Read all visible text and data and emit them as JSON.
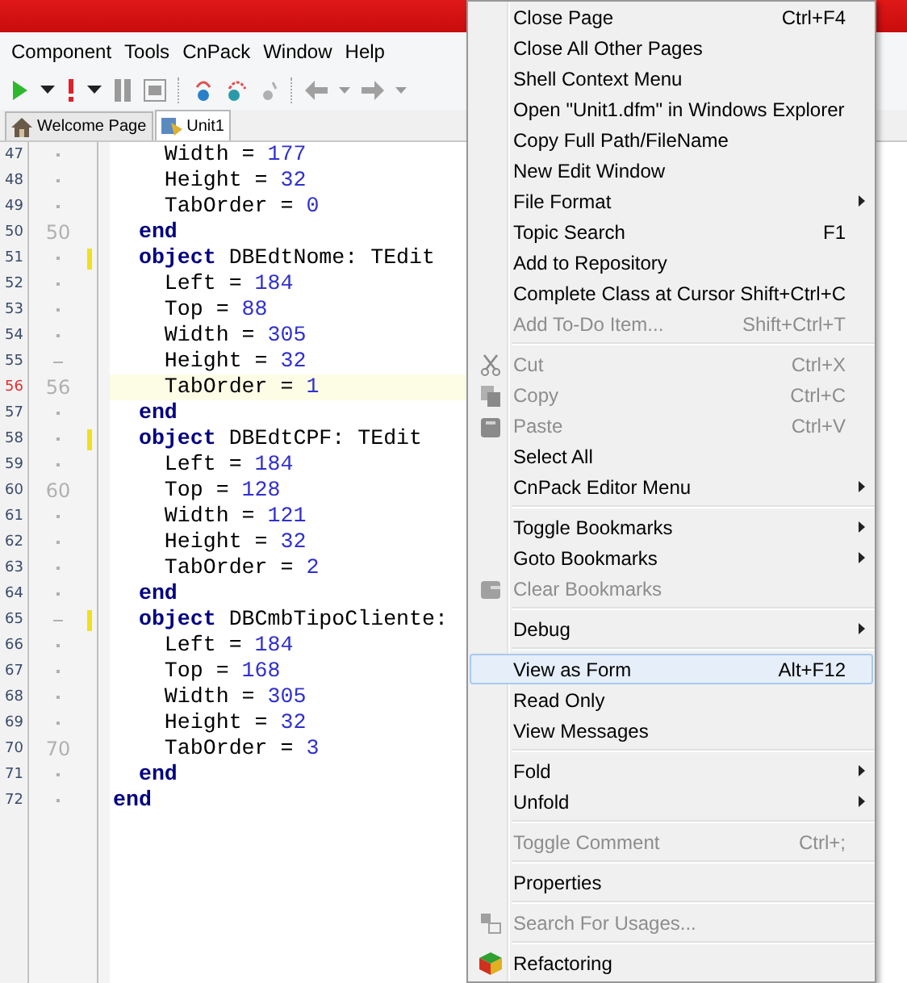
{
  "menubar": [
    "Component",
    "Tools",
    "CnPack",
    "Window",
    "Help"
  ],
  "tabs": [
    {
      "label": "Welcome Page",
      "selected": false
    },
    {
      "label": "Unit1",
      "selected": true
    }
  ],
  "editor": {
    "lines": [
      {
        "number": "47",
        "fold_start": false,
        "modified": false,
        "current": false,
        "tokens": [
          {
            "kind": "plain",
            "text": "    Width = "
          },
          {
            "kind": "number",
            "text": "177"
          }
        ]
      },
      {
        "number": "48",
        "fold_start": false,
        "modified": false,
        "current": false,
        "tokens": [
          {
            "kind": "plain",
            "text": "    Height = "
          },
          {
            "kind": "number",
            "text": "32"
          }
        ]
      },
      {
        "number": "49",
        "fold_start": false,
        "modified": false,
        "current": false,
        "tokens": [
          {
            "kind": "plain",
            "text": "    TabOrder = "
          },
          {
            "kind": "number",
            "text": "0"
          }
        ]
      },
      {
        "number": "50",
        "gutter_number": "50",
        "modified": false,
        "current": false,
        "tokens": [
          {
            "kind": "keyword",
            "text": "  end"
          }
        ]
      },
      {
        "number": "51",
        "fold_start": false,
        "modified": true,
        "current": false,
        "tokens": [
          {
            "kind": "keyword",
            "text": "  object"
          },
          {
            "kind": "plain",
            "text": " DBEdtNome: TEdit"
          }
        ]
      },
      {
        "number": "52",
        "fold_start": false,
        "modified": false,
        "current": false,
        "tokens": [
          {
            "kind": "plain",
            "text": "    Left = "
          },
          {
            "kind": "number",
            "text": "184"
          }
        ]
      },
      {
        "number": "53",
        "fold_start": false,
        "modified": false,
        "current": false,
        "tokens": [
          {
            "kind": "plain",
            "text": "    Top = "
          },
          {
            "kind": "number",
            "text": "88"
          }
        ]
      },
      {
        "number": "54",
        "fold_start": false,
        "modified": false,
        "current": false,
        "tokens": [
          {
            "kind": "plain",
            "text": "    Width = "
          },
          {
            "kind": "number",
            "text": "305"
          }
        ]
      },
      {
        "number": "55",
        "fold_start": true,
        "modified": false,
        "current": false,
        "tokens": [
          {
            "kind": "plain",
            "text": "    Height = "
          },
          {
            "kind": "number",
            "text": "32"
          }
        ]
      },
      {
        "number": "56",
        "gutter_number": "56",
        "modified": false,
        "current": true,
        "tokens": [
          {
            "kind": "plain",
            "text": "    TabOrder = "
          },
          {
            "kind": "number",
            "text": "1"
          }
        ]
      },
      {
        "number": "57",
        "fold_start": false,
        "modified": false,
        "current": false,
        "tokens": [
          {
            "kind": "keyword",
            "text": "  end"
          }
        ]
      },
      {
        "number": "58",
        "fold_start": false,
        "modified": true,
        "current": false,
        "tokens": [
          {
            "kind": "keyword",
            "text": "  object"
          },
          {
            "kind": "plain",
            "text": " DBEdtCPF: TEdit"
          }
        ]
      },
      {
        "number": "59",
        "fold_start": false,
        "modified": false,
        "current": false,
        "tokens": [
          {
            "kind": "plain",
            "text": "    Left = "
          },
          {
            "kind": "number",
            "text": "184"
          }
        ]
      },
      {
        "number": "60",
        "gutter_number": "60",
        "modified": false,
        "current": false,
        "tokens": [
          {
            "kind": "plain",
            "text": "    Top = "
          },
          {
            "kind": "number",
            "text": "128"
          }
        ]
      },
      {
        "number": "61",
        "fold_start": false,
        "modified": false,
        "current": false,
        "tokens": [
          {
            "kind": "plain",
            "text": "    Width = "
          },
          {
            "kind": "number",
            "text": "121"
          }
        ]
      },
      {
        "number": "62",
        "fold_start": false,
        "modified": false,
        "current": false,
        "tokens": [
          {
            "kind": "plain",
            "text": "    Height = "
          },
          {
            "kind": "number",
            "text": "32"
          }
        ]
      },
      {
        "number": "63",
        "fold_start": false,
        "modified": false,
        "current": false,
        "tokens": [
          {
            "kind": "plain",
            "text": "    TabOrder = "
          },
          {
            "kind": "number",
            "text": "2"
          }
        ]
      },
      {
        "number": "64",
        "fold_start": false,
        "modified": false,
        "current": false,
        "tokens": [
          {
            "kind": "keyword",
            "text": "  end"
          }
        ]
      },
      {
        "number": "65",
        "fold_start": true,
        "modified": true,
        "current": false,
        "tokens": [
          {
            "kind": "keyword",
            "text": "  object"
          },
          {
            "kind": "plain",
            "text": " DBCmbTipoCliente:"
          }
        ]
      },
      {
        "number": "66",
        "fold_start": false,
        "modified": false,
        "current": false,
        "tokens": [
          {
            "kind": "plain",
            "text": "    Left = "
          },
          {
            "kind": "number",
            "text": "184"
          }
        ]
      },
      {
        "number": "67",
        "fold_start": false,
        "modified": false,
        "current": false,
        "tokens": [
          {
            "kind": "plain",
            "text": "    Top = "
          },
          {
            "kind": "number",
            "text": "168"
          }
        ]
      },
      {
        "number": "68",
        "fold_start": false,
        "modified": false,
        "current": false,
        "tokens": [
          {
            "kind": "plain",
            "text": "    Width = "
          },
          {
            "kind": "number",
            "text": "305"
          }
        ]
      },
      {
        "number": "69",
        "fold_start": false,
        "modified": false,
        "current": false,
        "tokens": [
          {
            "kind": "plain",
            "text": "    Height = "
          },
          {
            "kind": "number",
            "text": "32"
          }
        ]
      },
      {
        "number": "70",
        "gutter_number": "70",
        "modified": false,
        "current": false,
        "tokens": [
          {
            "kind": "plain",
            "text": "    TabOrder = "
          },
          {
            "kind": "number",
            "text": "3"
          }
        ]
      },
      {
        "number": "71",
        "fold_start": false,
        "modified": false,
        "current": false,
        "tokens": [
          {
            "kind": "keyword",
            "text": "  end"
          }
        ]
      },
      {
        "number": "72",
        "fold_start": false,
        "modified": false,
        "current": false,
        "tokens": [
          {
            "kind": "keyword",
            "text": "end"
          }
        ]
      }
    ]
  },
  "context_menu": {
    "items": [
      {
        "kind": "item",
        "label": "Close Page",
        "shortcut": "Ctrl+F4",
        "submenu": false,
        "disabled": false,
        "selected": false
      },
      {
        "kind": "item",
        "label": "Close All Other Pages",
        "submenu": false,
        "disabled": false,
        "selected": false
      },
      {
        "kind": "item",
        "label": "Shell Context Menu",
        "submenu": false,
        "disabled": false,
        "selected": false
      },
      {
        "kind": "item",
        "label": "Open \"Unit1.dfm\" in Windows Explorer",
        "submenu": false,
        "disabled": false,
        "selected": false
      },
      {
        "kind": "item",
        "label": "Copy Full Path/FileName",
        "submenu": false,
        "disabled": false,
        "selected": false
      },
      {
        "kind": "item",
        "label": "New Edit Window",
        "submenu": false,
        "disabled": false,
        "selected": false
      },
      {
        "kind": "item",
        "label": "File Format",
        "submenu": true,
        "disabled": false,
        "selected": false
      },
      {
        "kind": "item",
        "label": "Topic Search",
        "shortcut": "F1",
        "submenu": false,
        "disabled": false,
        "selected": false
      },
      {
        "kind": "item",
        "label": "Add to Repository",
        "submenu": false,
        "disabled": false,
        "selected": false
      },
      {
        "kind": "item",
        "label": "Complete Class at Cursor",
        "shortcut": "Shift+Ctrl+C",
        "submenu": false,
        "disabled": false,
        "selected": false
      },
      {
        "kind": "item",
        "label": "Add To-Do Item...",
        "shortcut": "Shift+Ctrl+T",
        "submenu": false,
        "disabled": true,
        "selected": false
      },
      {
        "kind": "separator"
      },
      {
        "kind": "item",
        "label": "Cut",
        "shortcut": "Ctrl+X",
        "submenu": false,
        "disabled": true,
        "selected": false
      },
      {
        "kind": "item",
        "label": "Copy",
        "shortcut": "Ctrl+C",
        "submenu": false,
        "disabled": true,
        "selected": false
      },
      {
        "kind": "item",
        "label": "Paste",
        "shortcut": "Ctrl+V",
        "submenu": false,
        "disabled": true,
        "selected": false
      },
      {
        "kind": "item",
        "label": "Select All",
        "submenu": false,
        "disabled": false,
        "selected": false
      },
      {
        "kind": "item",
        "label": "CnPack Editor Menu",
        "submenu": true,
        "disabled": false,
        "selected": false
      },
      {
        "kind": "separator"
      },
      {
        "kind": "item",
        "label": "Toggle Bookmarks",
        "submenu": true,
        "disabled": false,
        "selected": false
      },
      {
        "kind": "item",
        "label": "Goto Bookmarks",
        "submenu": true,
        "disabled": false,
        "selected": false
      },
      {
        "kind": "item",
        "label": "Clear Bookmarks",
        "submenu": false,
        "disabled": true,
        "selected": false
      },
      {
        "kind": "separator"
      },
      {
        "kind": "item",
        "label": "Debug",
        "submenu": true,
        "disabled": false,
        "selected": false
      },
      {
        "kind": "separator"
      },
      {
        "kind": "item",
        "label": "View as Form",
        "shortcut": "Alt+F12",
        "submenu": false,
        "disabled": false,
        "selected": true
      },
      {
        "kind": "item",
        "label": "Read Only",
        "submenu": false,
        "disabled": false,
        "selected": false
      },
      {
        "kind": "item",
        "label": "View Messages",
        "submenu": false,
        "disabled": false,
        "selected": false
      },
      {
        "kind": "separator"
      },
      {
        "kind": "item",
        "label": "Fold",
        "submenu": true,
        "disabled": false,
        "selected": false
      },
      {
        "kind": "item",
        "label": "Unfold",
        "submenu": true,
        "disabled": false,
        "selected": false
      },
      {
        "kind": "separator"
      },
      {
        "kind": "item",
        "label": "Toggle Comment",
        "shortcut": "Ctrl+;",
        "submenu": false,
        "disabled": true,
        "selected": false
      },
      {
        "kind": "separator"
      },
      {
        "kind": "item",
        "label": "Properties",
        "submenu": false,
        "disabled": false,
        "selected": false
      },
      {
        "kind": "separator"
      },
      {
        "kind": "item",
        "label": "Search For Usages...",
        "submenu": false,
        "disabled": true,
        "selected": false
      },
      {
        "kind": "separator"
      },
      {
        "kind": "item",
        "label": "Refactoring",
        "submenu": false,
        "disabled": false,
        "selected": false
      }
    ]
  }
}
